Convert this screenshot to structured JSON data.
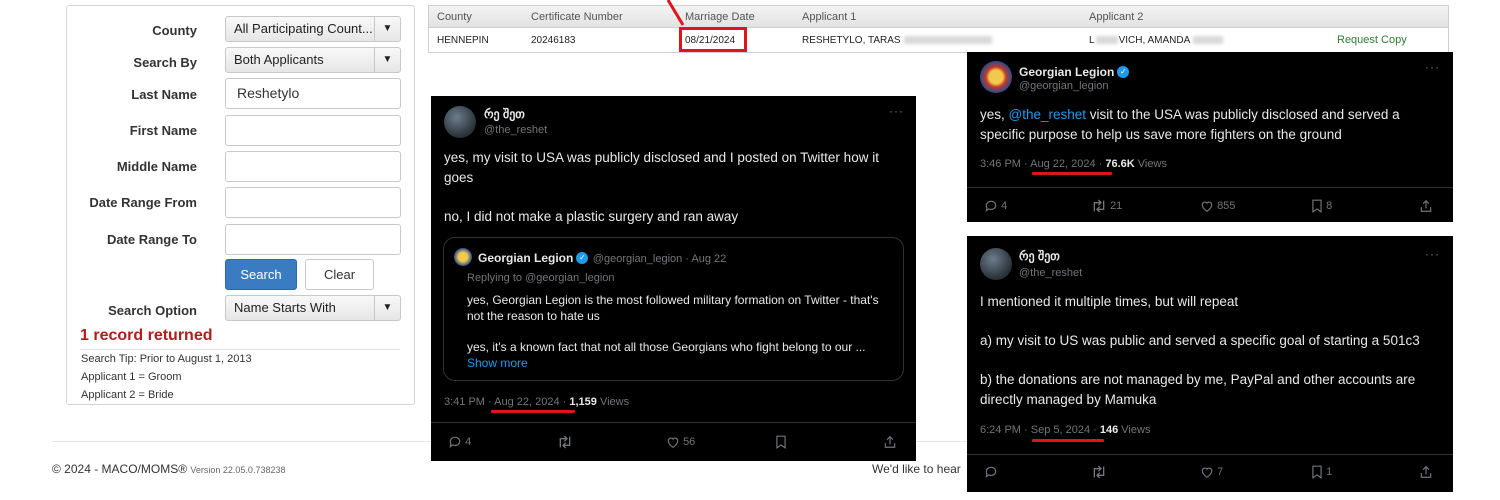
{
  "form": {
    "county_label": "County",
    "county_value": "All Participating Count...",
    "search_by_label": "Search By",
    "search_by_value": "Both Applicants",
    "last_name_label": "Last Name",
    "last_name_value": "Reshetylo",
    "first_name_label": "First Name",
    "middle_name_label": "Middle Name",
    "date_from_label": "Date Range From",
    "date_to_label": "Date Range To",
    "search_button": "Search",
    "clear_button": "Clear",
    "search_option_label": "Search Option",
    "search_option_value": "Name Starts With",
    "records_returned": "1 record returned",
    "tips": [
      "Search Tip: Prior to August 1, 2013",
      "Applicant 1 = Groom",
      "Applicant 2 = Bride"
    ]
  },
  "results": {
    "headers": [
      "County",
      "Certificate Number",
      "Marriage Date",
      "Applicant 1",
      "Applicant 2"
    ],
    "row": {
      "county": "HENNEPIN",
      "certificate": "20246183",
      "date": "08/21/2024",
      "applicant1": "RESHETYLO, TARAS",
      "applicant2_visible": "L",
      "applicant2_rest": "VICH, AMANDA",
      "action": "Request Copy"
    },
    "highlight_color": "#e0141b"
  },
  "footer": {
    "copyright": "© 2024 - MACO/MOMS®",
    "version": "Version 22.05.0.738238",
    "feedback": "We'd like to hear"
  },
  "tweet_main": {
    "name": "რე შეთ",
    "handle": "@the_reshet",
    "text1": "yes, my visit to USA was publicly disclosed and I posted on Twitter how it goes",
    "text2": "no, I did not make a plastic surgery and ran away",
    "quote": {
      "name": "Georgian Legion",
      "handle_date": "@georgian_legion · Aug 22",
      "replying": "Replying to @georgian_legion",
      "text1": "yes, Georgian Legion is the most followed military formation on Twitter - that's not the reason to hate us",
      "text2": "yes, it's a known fact that not all those Georgians who fight belong to our ...",
      "show_more": "Show more"
    },
    "time": "3:41 PM",
    "date": "Aug 22, 2024",
    "views_count": "1,159",
    "views_label": "Views",
    "replies": "4",
    "likes": "56"
  },
  "tweet_legion": {
    "name": "Georgian Legion",
    "handle": "@georgian_legion",
    "mention": "@the_reshet",
    "text_before": "yes, ",
    "text_after": " visit to the USA was publicly disclosed and served a specific purpose to help us save more fighters on the ground",
    "time": "3:46 PM",
    "date": "Aug 22, 2024",
    "views_count": "76.6K",
    "views_label": "Views",
    "replies": "4",
    "reposts": "21",
    "likes": "855",
    "bookmarks": "8"
  },
  "tweet_reshet2": {
    "name": "რე შეთ",
    "handle": "@the_reshet",
    "text1": "I mentioned it multiple times, but will repeat",
    "text2": "a) my visit to US was public and served a specific goal of starting a 501c3",
    "text3": "b) the donations are not managed by me, PayPal and other accounts are directly managed by Mamuka",
    "time": "6:24 PM",
    "date": "Sep 5, 2024",
    "views_count": "146",
    "views_label": "Views",
    "likes": "7",
    "bookmarks": "1"
  },
  "icons": [
    "chevron-down-icon",
    "reply-icon",
    "repost-icon",
    "like-icon",
    "bookmark-icon",
    "share-icon",
    "verified-icon",
    "more-icon"
  ]
}
